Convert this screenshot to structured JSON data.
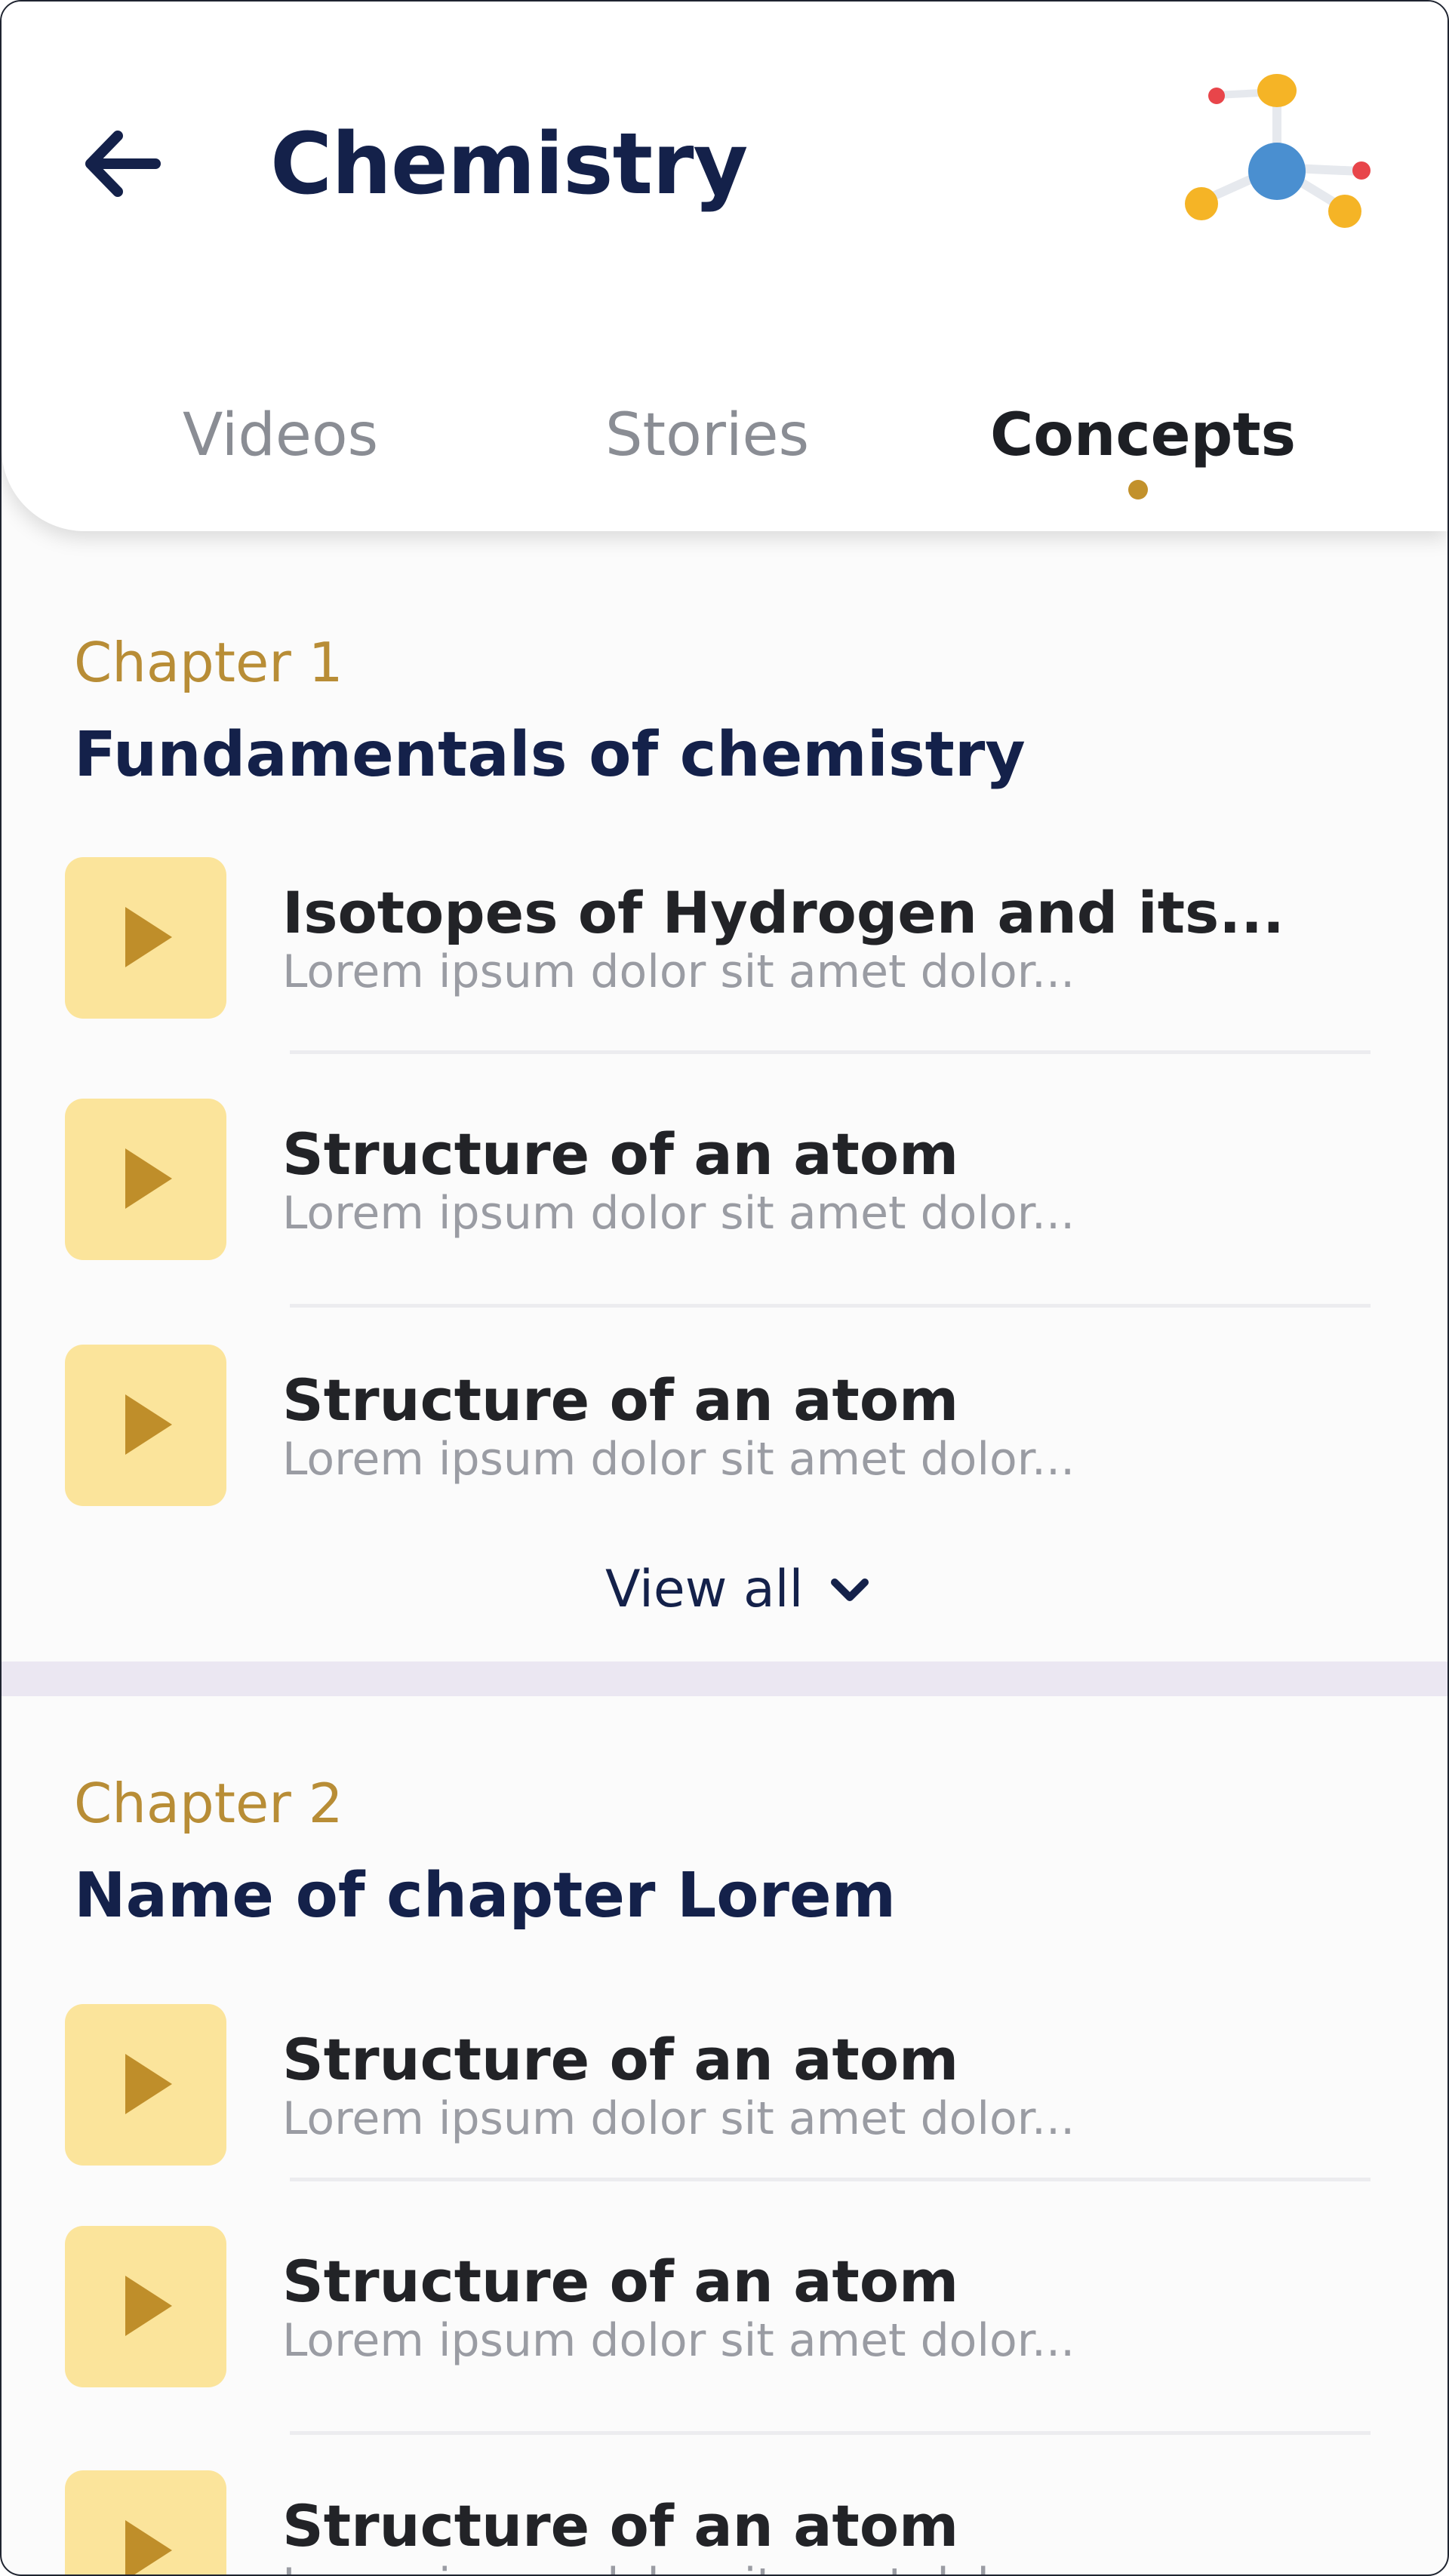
{
  "header": {
    "title": "Chemistry",
    "back_icon": "back-arrow-icon",
    "logo_icon": "molecule-icon"
  },
  "tabs": [
    {
      "label": "Videos",
      "active": false
    },
    {
      "label": "Stories",
      "active": false
    },
    {
      "label": "Concepts",
      "active": true
    }
  ],
  "chapters": [
    {
      "label": "Chapter 1",
      "title": "Fundamentals of chemistry",
      "items": [
        {
          "title": "Isotopes of Hydrogen and its...",
          "subtitle": "Lorem ipsum dolor sit amet dolor..."
        },
        {
          "title": "Structure of an atom",
          "subtitle": "Lorem ipsum dolor sit amet dolor..."
        },
        {
          "title": "Structure of an atom",
          "subtitle": "Lorem ipsum dolor sit amet dolor..."
        }
      ],
      "view_all_label": "View all"
    },
    {
      "label": "Chapter 2",
      "title": "Name of chapter Lorem",
      "items": [
        {
          "title": "Structure of an atom",
          "subtitle": "Lorem ipsum dolor sit amet dolor..."
        },
        {
          "title": "Structure of an atom",
          "subtitle": "Lorem ipsum dolor sit amet dolor..."
        },
        {
          "title": "Structure of an atom",
          "subtitle": "Lorem ipsum dolor sit amet dolor..."
        }
      ]
    }
  ],
  "colors": {
    "primary": "#14214a",
    "accent": "#c2912b",
    "thumb_bg": "#fbe49b",
    "muted": "#9a9ca3"
  }
}
